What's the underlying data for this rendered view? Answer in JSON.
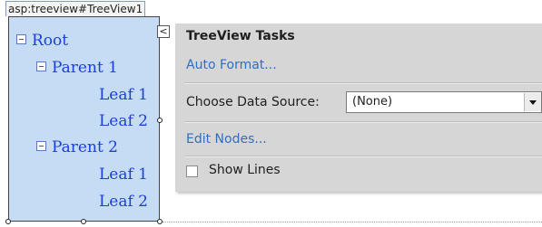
{
  "control_tag": "asp:treeview#TreeView1",
  "tree": {
    "nodes": [
      {
        "label": "Root",
        "expander": "collapse"
      },
      {
        "label": "Parent 1",
        "expander": "collapse"
      },
      {
        "label": "Leaf 1"
      },
      {
        "label": "Leaf 2"
      },
      {
        "label": "Parent 2",
        "expander": "collapse"
      },
      {
        "label": "Leaf 1"
      },
      {
        "label": "Leaf 2"
      }
    ]
  },
  "smart_tag": {
    "glyph": "<"
  },
  "tasks": {
    "title": "TreeView Tasks",
    "auto_format_link": "Auto Format...",
    "data_source_label": "Choose Data Source:",
    "data_source_value": "(None)",
    "edit_nodes_link": "Edit Nodes...",
    "show_lines_label": "Show Lines",
    "show_lines_checked": false
  },
  "colors": {
    "tree_background": "#c6dcf5",
    "tree_text": "#1a3fdc",
    "panel_background": "#d6d6d6",
    "link": "#2f6fc2"
  }
}
